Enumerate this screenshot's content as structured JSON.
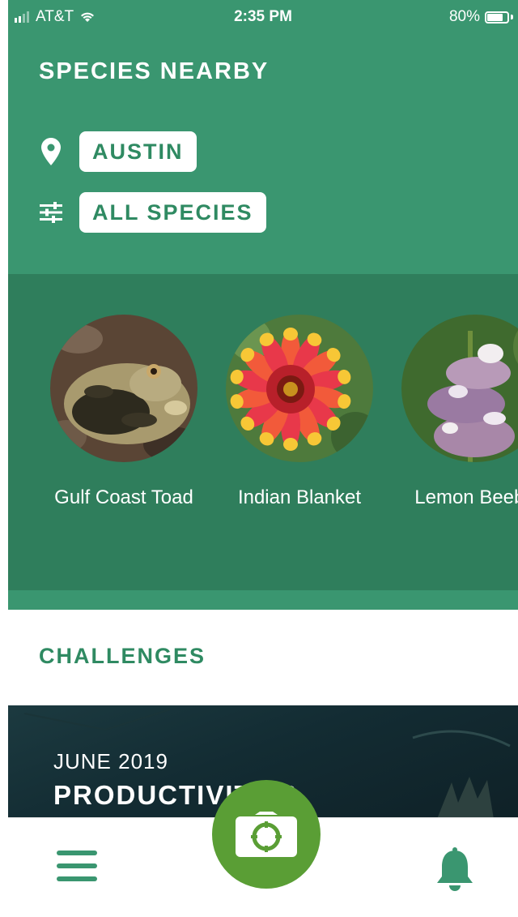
{
  "status_bar": {
    "carrier": "AT&T",
    "time": "2:35 PM",
    "battery_percent": "80%",
    "battery_level": 0.8,
    "signal_bars": 4,
    "signal_bars_filled": 2
  },
  "header": {
    "title": "SPECIES NEARBY",
    "location_label": "AUSTIN",
    "location_icon": "map-pin-icon",
    "filter_label": "ALL SPECIES",
    "filter_icon": "sliders-icon"
  },
  "species": [
    {
      "name": "Gulf Coast Toad"
    },
    {
      "name": "Indian Blanket"
    },
    {
      "name": "Lemon Beeba"
    }
  ],
  "challenges": {
    "title": "CHALLENGES",
    "card": {
      "date": "JUNE 2019",
      "name": "PRODUCTIVITY &"
    }
  },
  "bottom_nav": {
    "menu_icon": "hamburger-menu-icon",
    "camera_icon": "camera-icon",
    "notifications_icon": "bell-icon"
  },
  "colors": {
    "header_green": "#3a9670",
    "carousel_green": "#2f7e5c",
    "accent_text": "#2f8a62",
    "camera_green": "#5a9e35"
  }
}
